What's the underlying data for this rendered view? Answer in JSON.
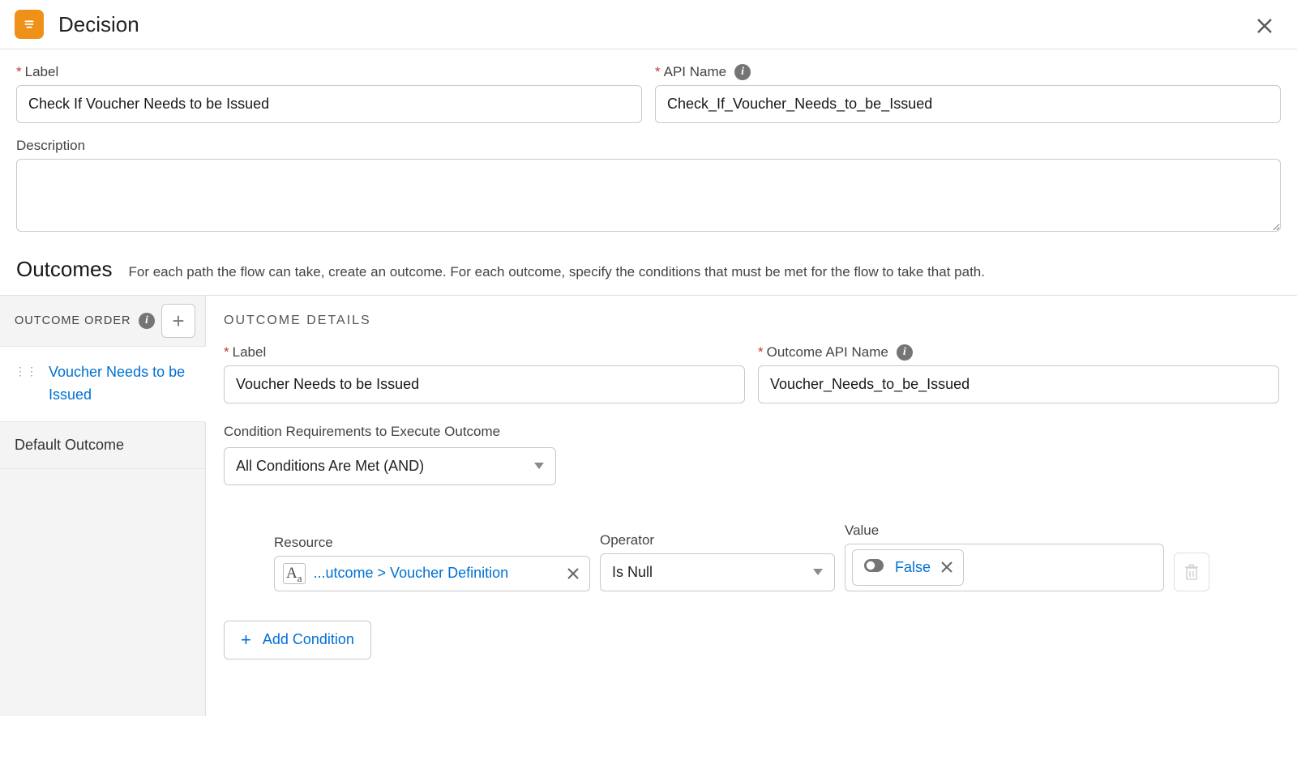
{
  "header": {
    "title": "Decision"
  },
  "form": {
    "label_label": "Label",
    "label_value": "Check If Voucher Needs to be Issued",
    "api_label": "API Name",
    "api_value": "Check_If_Voucher_Needs_to_be_Issued",
    "description_label": "Description",
    "description_value": ""
  },
  "outcomes": {
    "title": "Outcomes",
    "hint": "For each path the flow can take, create an outcome. For each outcome, specify the conditions that must be met for the flow to take that path."
  },
  "sidebar": {
    "order_label": "OUTCOME ORDER",
    "items": [
      {
        "label": "Voucher Needs to be Issued"
      },
      {
        "label": "Default Outcome"
      }
    ]
  },
  "details": {
    "section": "OUTCOME DETAILS",
    "label_label": "Label",
    "label_value": "Voucher Needs to be Issued",
    "api_label": "Outcome API Name",
    "api_value": "Voucher_Needs_to_be_Issued",
    "cond_req_label": "Condition Requirements to Execute Outcome",
    "cond_req_value": "All Conditions Are Met (AND)",
    "cond_header": {
      "resource": "Resource",
      "operator": "Operator",
      "value": "Value"
    },
    "cond": {
      "resource_text": "...utcome > Voucher Definition",
      "operator_text": "Is Null",
      "value_text": "False"
    },
    "add_cond_label": "Add Condition"
  }
}
